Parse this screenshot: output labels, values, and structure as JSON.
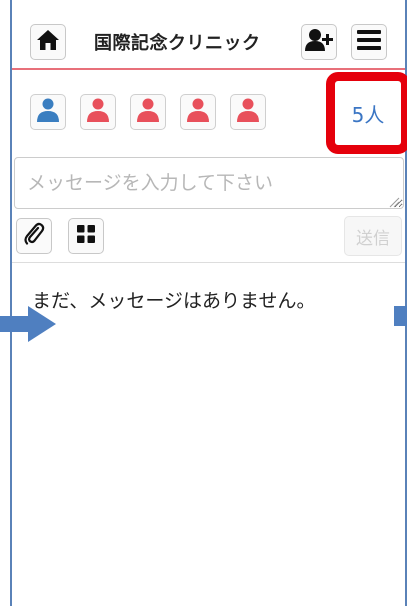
{
  "header": {
    "title": "国際記念クリニック",
    "icons": [
      "home-icon",
      "add-user-icon",
      "menu-icon"
    ]
  },
  "members": {
    "items": [
      {
        "role": "staff",
        "color": "#3a7ec0"
      },
      {
        "role": "member",
        "color": "#e8505b"
      },
      {
        "role": "member",
        "color": "#e8505b"
      },
      {
        "role": "member",
        "color": "#e8505b"
      },
      {
        "role": "member",
        "color": "#e8505b"
      }
    ],
    "count_label": "5人"
  },
  "composer": {
    "placeholder": "メッセージを入力して下さい",
    "value": "",
    "send_label": "送信",
    "icons": [
      "attachment-icon",
      "stamp-grid-icon"
    ]
  },
  "messages": {
    "empty_text": "まだ、メッセージはありません。"
  },
  "colors": {
    "accent_blue": "#3b76c4",
    "header_line": "#e8707a",
    "highlight_red": "#e5000b",
    "annotation_blue": "#4f7fc0"
  }
}
